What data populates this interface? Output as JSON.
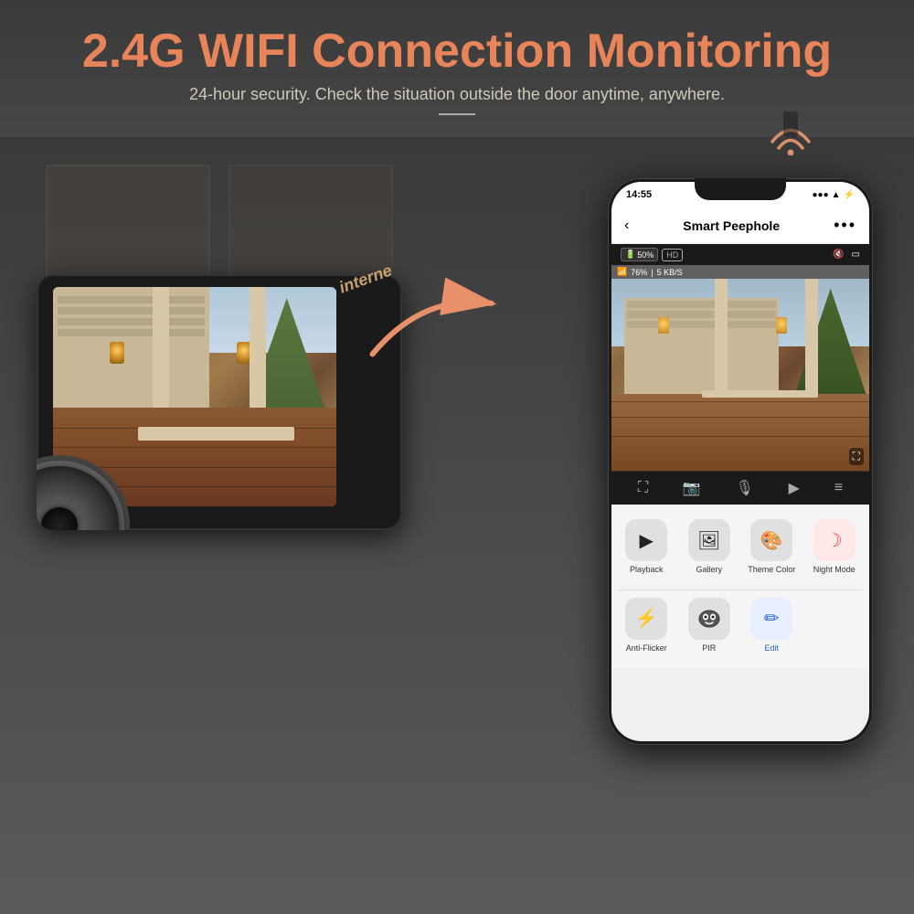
{
  "header": {
    "title": "2.4G WIFI Connection Monitoring",
    "subtitle": "24-hour security. Check the situation outside the door anytime, anywhere.",
    "divider": true
  },
  "arrow": {
    "label": "interne"
  },
  "wifi_signal": {
    "visible": true
  },
  "phone": {
    "status_bar": {
      "time": "14:55",
      "signal": "●●●",
      "wifi": "▲",
      "battery": "⚡"
    },
    "app_bar": {
      "back": "‹",
      "title": "Smart Peephole",
      "more": "•••"
    },
    "cam_toolbar": {
      "battery": "50%",
      "quality": "HD",
      "mute_icon": "🔇",
      "screen_icon": "▭",
      "wifi_pct": "76%",
      "speed": "5 KB/S"
    },
    "controls": [
      "⛶",
      "📷",
      "🎙",
      "▶",
      "≡"
    ],
    "app_icons": [
      {
        "label": "Playback",
        "color": "#222",
        "icon": "▶",
        "bg": "#e8e8e8"
      },
      {
        "label": "Gallery",
        "color": "#222",
        "icon": "🖼",
        "bg": "#e8e8e8"
      },
      {
        "label": "Theme Color",
        "color": "#222",
        "icon": "🎨",
        "bg": "#e8e8e8"
      },
      {
        "label": "Night Mode",
        "color": "#e85050",
        "icon": "☽",
        "bg": "#fee8e8"
      }
    ],
    "app_icons2": [
      {
        "label": "Anti-Flicker",
        "color": "#222",
        "icon": "⚡",
        "bg": "#e8e8e8"
      },
      {
        "label": "PIR",
        "color": "#222",
        "icon": "👁",
        "bg": "#e8e8e8"
      },
      {
        "label": "Edit",
        "color": "#2266cc",
        "icon": "✏",
        "bg": "#e8f0ff"
      }
    ]
  }
}
